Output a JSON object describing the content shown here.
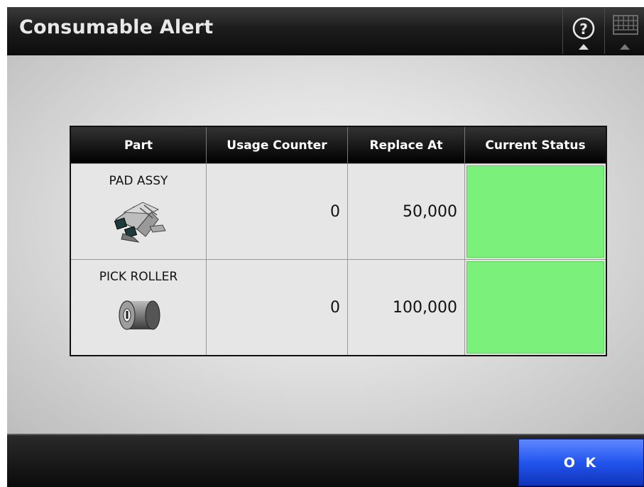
{
  "window": {
    "title": "Consumable Alert"
  },
  "toolbar": {
    "help_icon": "help-icon",
    "keyboard_icon": "keyboard-icon"
  },
  "table": {
    "headers": [
      "Part",
      "Usage Counter",
      "Replace At",
      "Current Status"
    ],
    "rows": [
      {
        "part": "PAD ASSY",
        "icon": "pad-assy-icon",
        "usage": "0",
        "replace_at": "50,000",
        "status_color": "#7bf07b"
      },
      {
        "part": "PICK ROLLER",
        "icon": "pick-roller-icon",
        "usage": "0",
        "replace_at": "100,000",
        "status_color": "#7bf07b"
      }
    ]
  },
  "footer": {
    "ok_label": "O K"
  },
  "colors": {
    "ok_button": "#2255ee",
    "status_ok": "#7bf07b",
    "titlebar": "#1c1c1c"
  }
}
